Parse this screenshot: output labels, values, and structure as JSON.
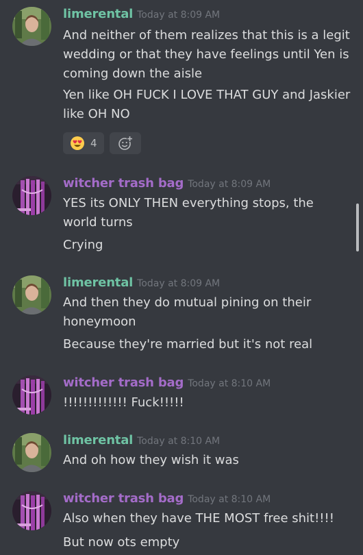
{
  "messages": [
    {
      "author": "limerental",
      "timestamp": "Today at 8:09 AM",
      "lines": [
        "And neither of them realizes that this is a legit wedding or that they have feelings until Yen is coming down the aisle",
        "Yen like OH FUCK I LOVE THAT GUY and Jaskier like OH NO"
      ],
      "reaction": {
        "emoji": "heart-eyes-emoji",
        "count": "4"
      }
    },
    {
      "author": "witcher trash bag",
      "timestamp": "Today at 8:09 AM",
      "lines": [
        "YES its ONLY THEN everything stops, the world turns",
        "Crying"
      ]
    },
    {
      "author": "limerental",
      "timestamp": "Today at 8:09 AM",
      "lines": [
        "And then they do mutual pining on their honeymoon",
        "Because they're married but it's not real"
      ]
    },
    {
      "author": "witcher trash bag",
      "timestamp": "Today at 8:10 AM",
      "lines": [
        "!!!!!!!!!!!!! Fuck!!!!!"
      ]
    },
    {
      "author": "limerental",
      "timestamp": "Today at 8:10 AM",
      "lines": [
        "And oh how they wish it was"
      ]
    },
    {
      "author": "witcher trash bag",
      "timestamp": "Today at 8:10 AM",
      "lines": [
        "Also when they have THE MOST free shit!!!!",
        "But now ots empty"
      ]
    }
  ],
  "colors": {
    "background": "#36393f",
    "username_limerental": "#6fc3a4",
    "username_witcher": "#a46cc9",
    "message_text": "#dcddde",
    "timestamp": "#72767d"
  }
}
